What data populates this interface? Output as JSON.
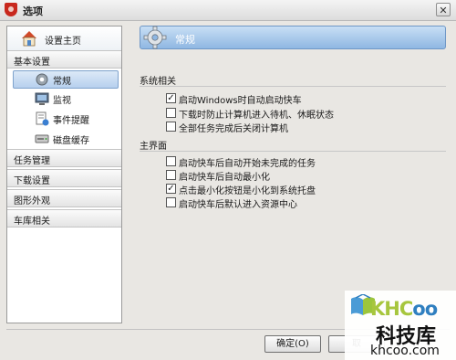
{
  "window": {
    "title": "选项",
    "close_glyph": "✕"
  },
  "sidebar": {
    "home_label": "设置主页",
    "categories": [
      {
        "label": "基本设置"
      },
      {
        "label": "任务管理"
      },
      {
        "label": "下载设置"
      },
      {
        "label": "图形外观"
      },
      {
        "label": "车库相关"
      }
    ],
    "subitems": [
      {
        "label": "常规",
        "icon": "gear-icon",
        "selected": true
      },
      {
        "label": "监视",
        "icon": "monitor-icon",
        "selected": false
      },
      {
        "label": "事件提醒",
        "icon": "reminder-icon",
        "selected": false
      },
      {
        "label": "磁盘缓存",
        "icon": "disk-icon",
        "selected": false
      }
    ]
  },
  "header": {
    "title": "常规",
    "icon": "gear-icon"
  },
  "sections": [
    {
      "title": "系统相关",
      "options": [
        {
          "label": "启动Windows时自动启动快车",
          "checked": true
        },
        {
          "label": "下载时防止计算机进入待机、休眠状态",
          "checked": false
        },
        {
          "label": "全部任务完成后关闭计算机",
          "checked": false
        }
      ]
    },
    {
      "title": "主界面",
      "options": [
        {
          "label": "启动快车后自动开始未完成的任务",
          "checked": false
        },
        {
          "label": "启动快车后自动最小化",
          "checked": false
        },
        {
          "label": "点击最小化按钮是小化到系统托盘",
          "checked": true
        },
        {
          "label": "启动快车后默认进入资源中心",
          "checked": false
        }
      ]
    }
  ],
  "buttons": {
    "ok": "确定(O)",
    "cancel": "取"
  },
  "watermark": {
    "brand_prefix": "KHC",
    "brand_suffix": "oo",
    "chinese": "科技库",
    "url": "khcoo.com"
  },
  "colors": {
    "header_bg": "#8fb7e2",
    "selected_bg": "#b7d0ee",
    "brand_green": "#a7c63e",
    "brand_blue": "#2f7fc0"
  }
}
